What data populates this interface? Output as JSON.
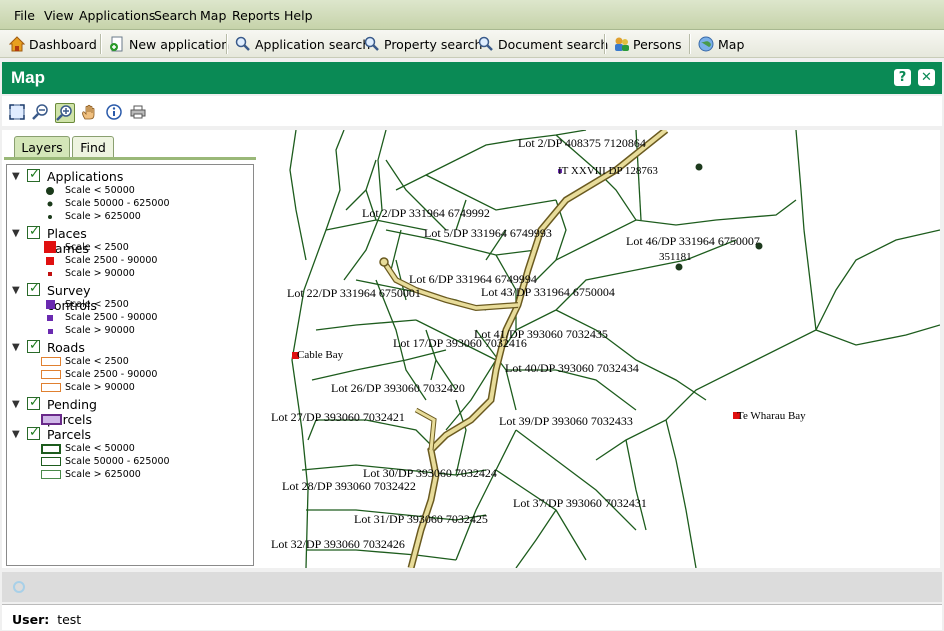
{
  "menu": [
    "File",
    "View",
    "Applications",
    "Search",
    "Map",
    "Reports",
    "Help"
  ],
  "toolbar": {
    "dashboard": "Dashboard",
    "new_application": "New application",
    "application_search": "Application search",
    "property_search": "Property search",
    "document_search": "Document search",
    "persons": "Persons",
    "map": "Map"
  },
  "page_title": "Map",
  "title_buttons": {
    "help": "?",
    "close": "✕"
  },
  "tabs": {
    "layers": "Layers",
    "find": "Find"
  },
  "layers": [
    {
      "name": "Applications",
      "checked": true,
      "legend": [
        "Scale < 50000",
        "Scale 50000 - 625000",
        "Scale > 625000"
      ]
    },
    {
      "name": "Places names",
      "checked": true,
      "legend": [
        "Scale < 2500",
        "Scale 2500 - 90000",
        "Scale > 90000"
      ]
    },
    {
      "name": "Survey controls",
      "checked": true,
      "legend": [
        "Scale < 2500",
        "Scale 2500 - 90000",
        "Scale > 90000"
      ]
    },
    {
      "name": "Roads",
      "checked": true,
      "legend": [
        "Scale < 2500",
        "Scale 2500 - 90000",
        "Scale > 90000"
      ]
    },
    {
      "name": "Pending parcels",
      "checked": true,
      "legend": []
    },
    {
      "name": "Parcels",
      "checked": true,
      "legend": [
        "Scale < 50000",
        "Scale 50000 - 625000",
        "Scale > 625000"
      ]
    }
  ],
  "map_labels": {
    "l1": "Lot 2/DP 408375 7120864",
    "l2": "IT XXVIII DP 128763",
    "l3": "Lot 2/DP 331964 6749992",
    "l4": "Lot 5/DP 331964 6749993",
    "l5": "Lot 46/DP 331964 6750007",
    "l6": "351181",
    "l7": "Lot 6/DP 331964 6749994",
    "l8": "Lot 22/DP 331964 6750001",
    "l9": "Lot 43/DP 331964 6750004",
    "l10": "Lot 41/DP 393060 7032435",
    "l11": "Lot 17/DP 393060 7032416",
    "l12": "Cable Bay",
    "l13": "Lot 40/DP 393060 7032434",
    "l14": "Lot 26/DP 393060 7032420",
    "l15": "Te Wharau Bay",
    "l16": "Lot 27/DP 393060 7032421",
    "l17": "Lot 39/DP 393060 7032433",
    "l18": "Lot 30/DP 393060 7032424",
    "l19": "Lot 28/DP 393060 7032422",
    "l20": "Lot 37/DP 393060 7032431",
    "l21": "Lot 31/DP 393060 7032425",
    "l22": "Lot 32/DP 393060 7032426"
  },
  "footer": {
    "user_label": "User:",
    "user_value": "test"
  },
  "colors": {
    "accent": "#0a8a55",
    "parcel": "#1d5c1d",
    "road": "#c8b45a",
    "place": "#e01010"
  }
}
